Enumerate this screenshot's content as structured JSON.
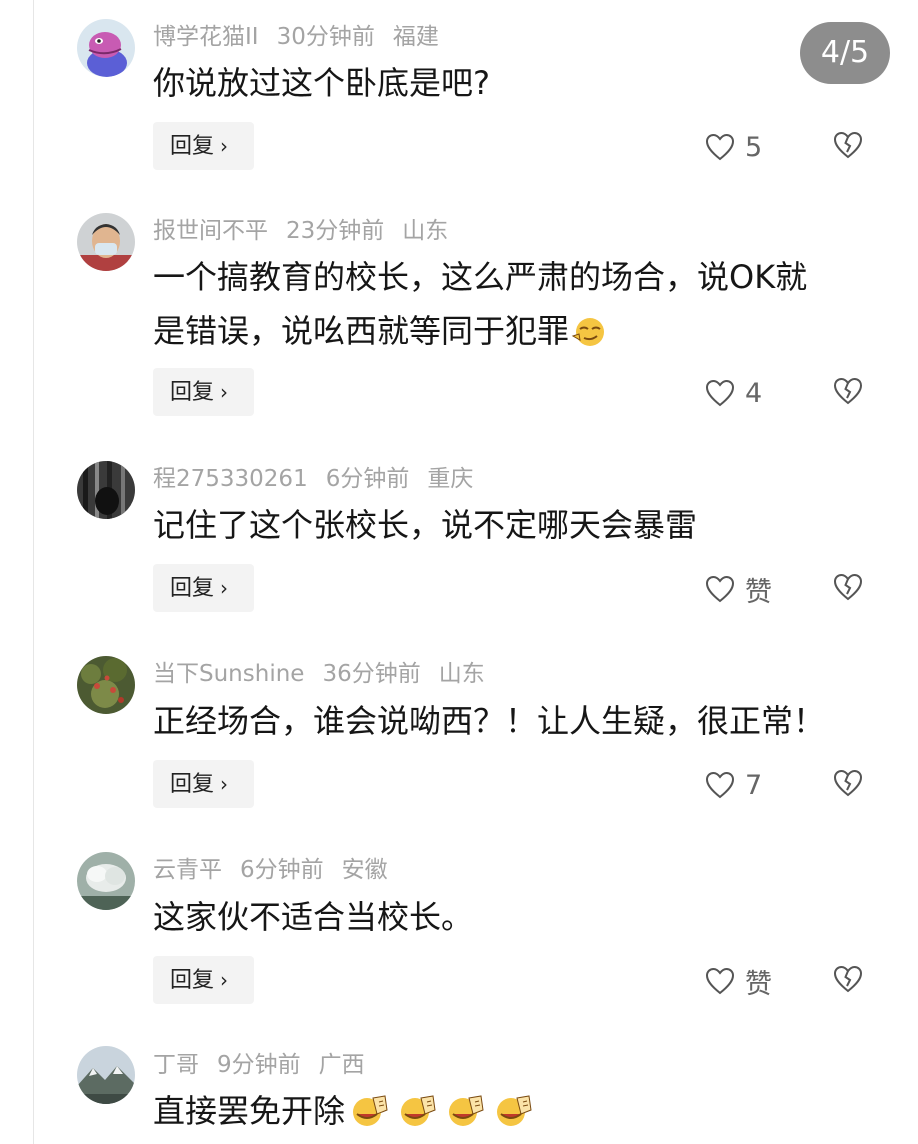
{
  "page_badge": "4/5",
  "reply_label": "回复",
  "reply_chevron": "›",
  "icons": {
    "like": "heart-outline-icon",
    "dislike": "broken-heart-icon",
    "reply_chevron": "chevron-right-icon"
  },
  "colors": {
    "meta_text": "#a4a4a4",
    "body_text": "#161616",
    "reply_bg": "#f3f3f3",
    "badge_bg": "#8d8d8d"
  },
  "comments": [
    {
      "username": "博学花猫II",
      "time": "30分钟前",
      "location": "福建",
      "text_lines": [
        "你说放过这个卧底是吧?"
      ],
      "likes": "5"
    },
    {
      "username": "报世间不平",
      "time": "23分钟前",
      "location": "山东",
      "text_lines": [
        "一个搞教育的校长，这么严肃的场合，说OK就",
        "是错误，说吆西就等同于犯罪"
      ],
      "emoji": "smirk-emoji",
      "likes": "4"
    },
    {
      "username": "程275330261",
      "time": "6分钟前",
      "location": "重庆",
      "text_lines": [
        "记住了这个张校长，说不定哪天会暴雷"
      ],
      "likes": "赞"
    },
    {
      "username": "当下Sunshine",
      "time": "36分钟前",
      "location": "山东",
      "text_lines": [
        "正经场合，谁会说呦西？！让人生疑，很正常！"
      ],
      "likes": "7"
    },
    {
      "username": "云青平",
      "time": "6分钟前",
      "location": "安徽",
      "text_lines": [
        "这家伙不适合当校长。"
      ],
      "likes": "赞"
    },
    {
      "username": "丁哥",
      "time": "9分钟前",
      "location": "广西",
      "text_lines": [
        "直接罢免开除"
      ],
      "emoji": "clapping-emoji",
      "emoji_count": 4
    }
  ]
}
